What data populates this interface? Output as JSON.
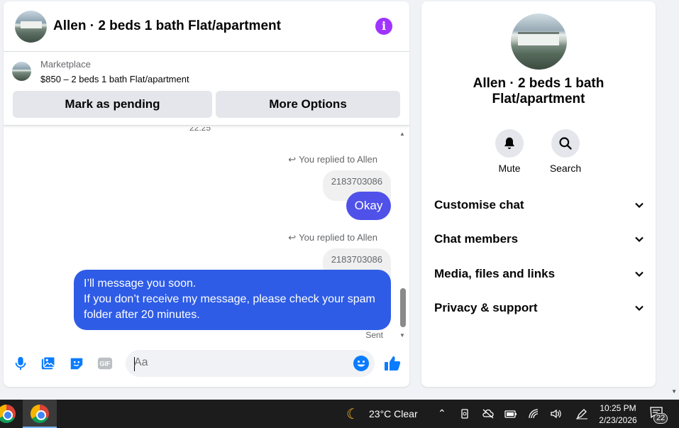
{
  "chat": {
    "title": "Allen · 2 beds 1 bath Flat/apartment",
    "listing": {
      "kicker": "Marketplace",
      "title": "$850 – 2 beds 1 bath Flat/apartment"
    },
    "buttons": {
      "pending": "Mark as pending",
      "options": "More Options"
    },
    "time_stub": "22:25",
    "messages": [
      {
        "reply_note": "You replied to Allen",
        "quoted": "2183703086",
        "text": "Okay"
      },
      {
        "reply_note": "You replied to Allen",
        "quoted": "2183703086",
        "lines": [
          "I’ll message you soon.",
          "If you don’t receive my message, please check your spam",
          "folder after 20 minutes."
        ]
      }
    ],
    "status": "Sent",
    "composer": {
      "placeholder": "Aa"
    }
  },
  "side": {
    "title": "Allen · 2 beds 1 bath Flat/apartment",
    "actions": {
      "mute": "Mute",
      "search": "Search"
    },
    "sections": [
      "Customise chat",
      "Chat members",
      "Media, files and links",
      "Privacy & support"
    ]
  },
  "taskbar": {
    "weather": "23°C  Clear",
    "time": "10:25 PM",
    "date": "2/23/2026",
    "notifications": "22"
  },
  "colors": {
    "accent": "#0a7cff",
    "bubble": "#2e5ce6",
    "info": "#a033ff"
  },
  "icons": [
    "info-icon",
    "reply-icon",
    "microphone-icon",
    "photo-icon",
    "sticker-icon",
    "gif-icon",
    "emoji-icon",
    "thumbs-up-icon",
    "bell-icon",
    "search-icon",
    "chevron-down-icon",
    "moon-icon",
    "chrome-icon"
  ]
}
